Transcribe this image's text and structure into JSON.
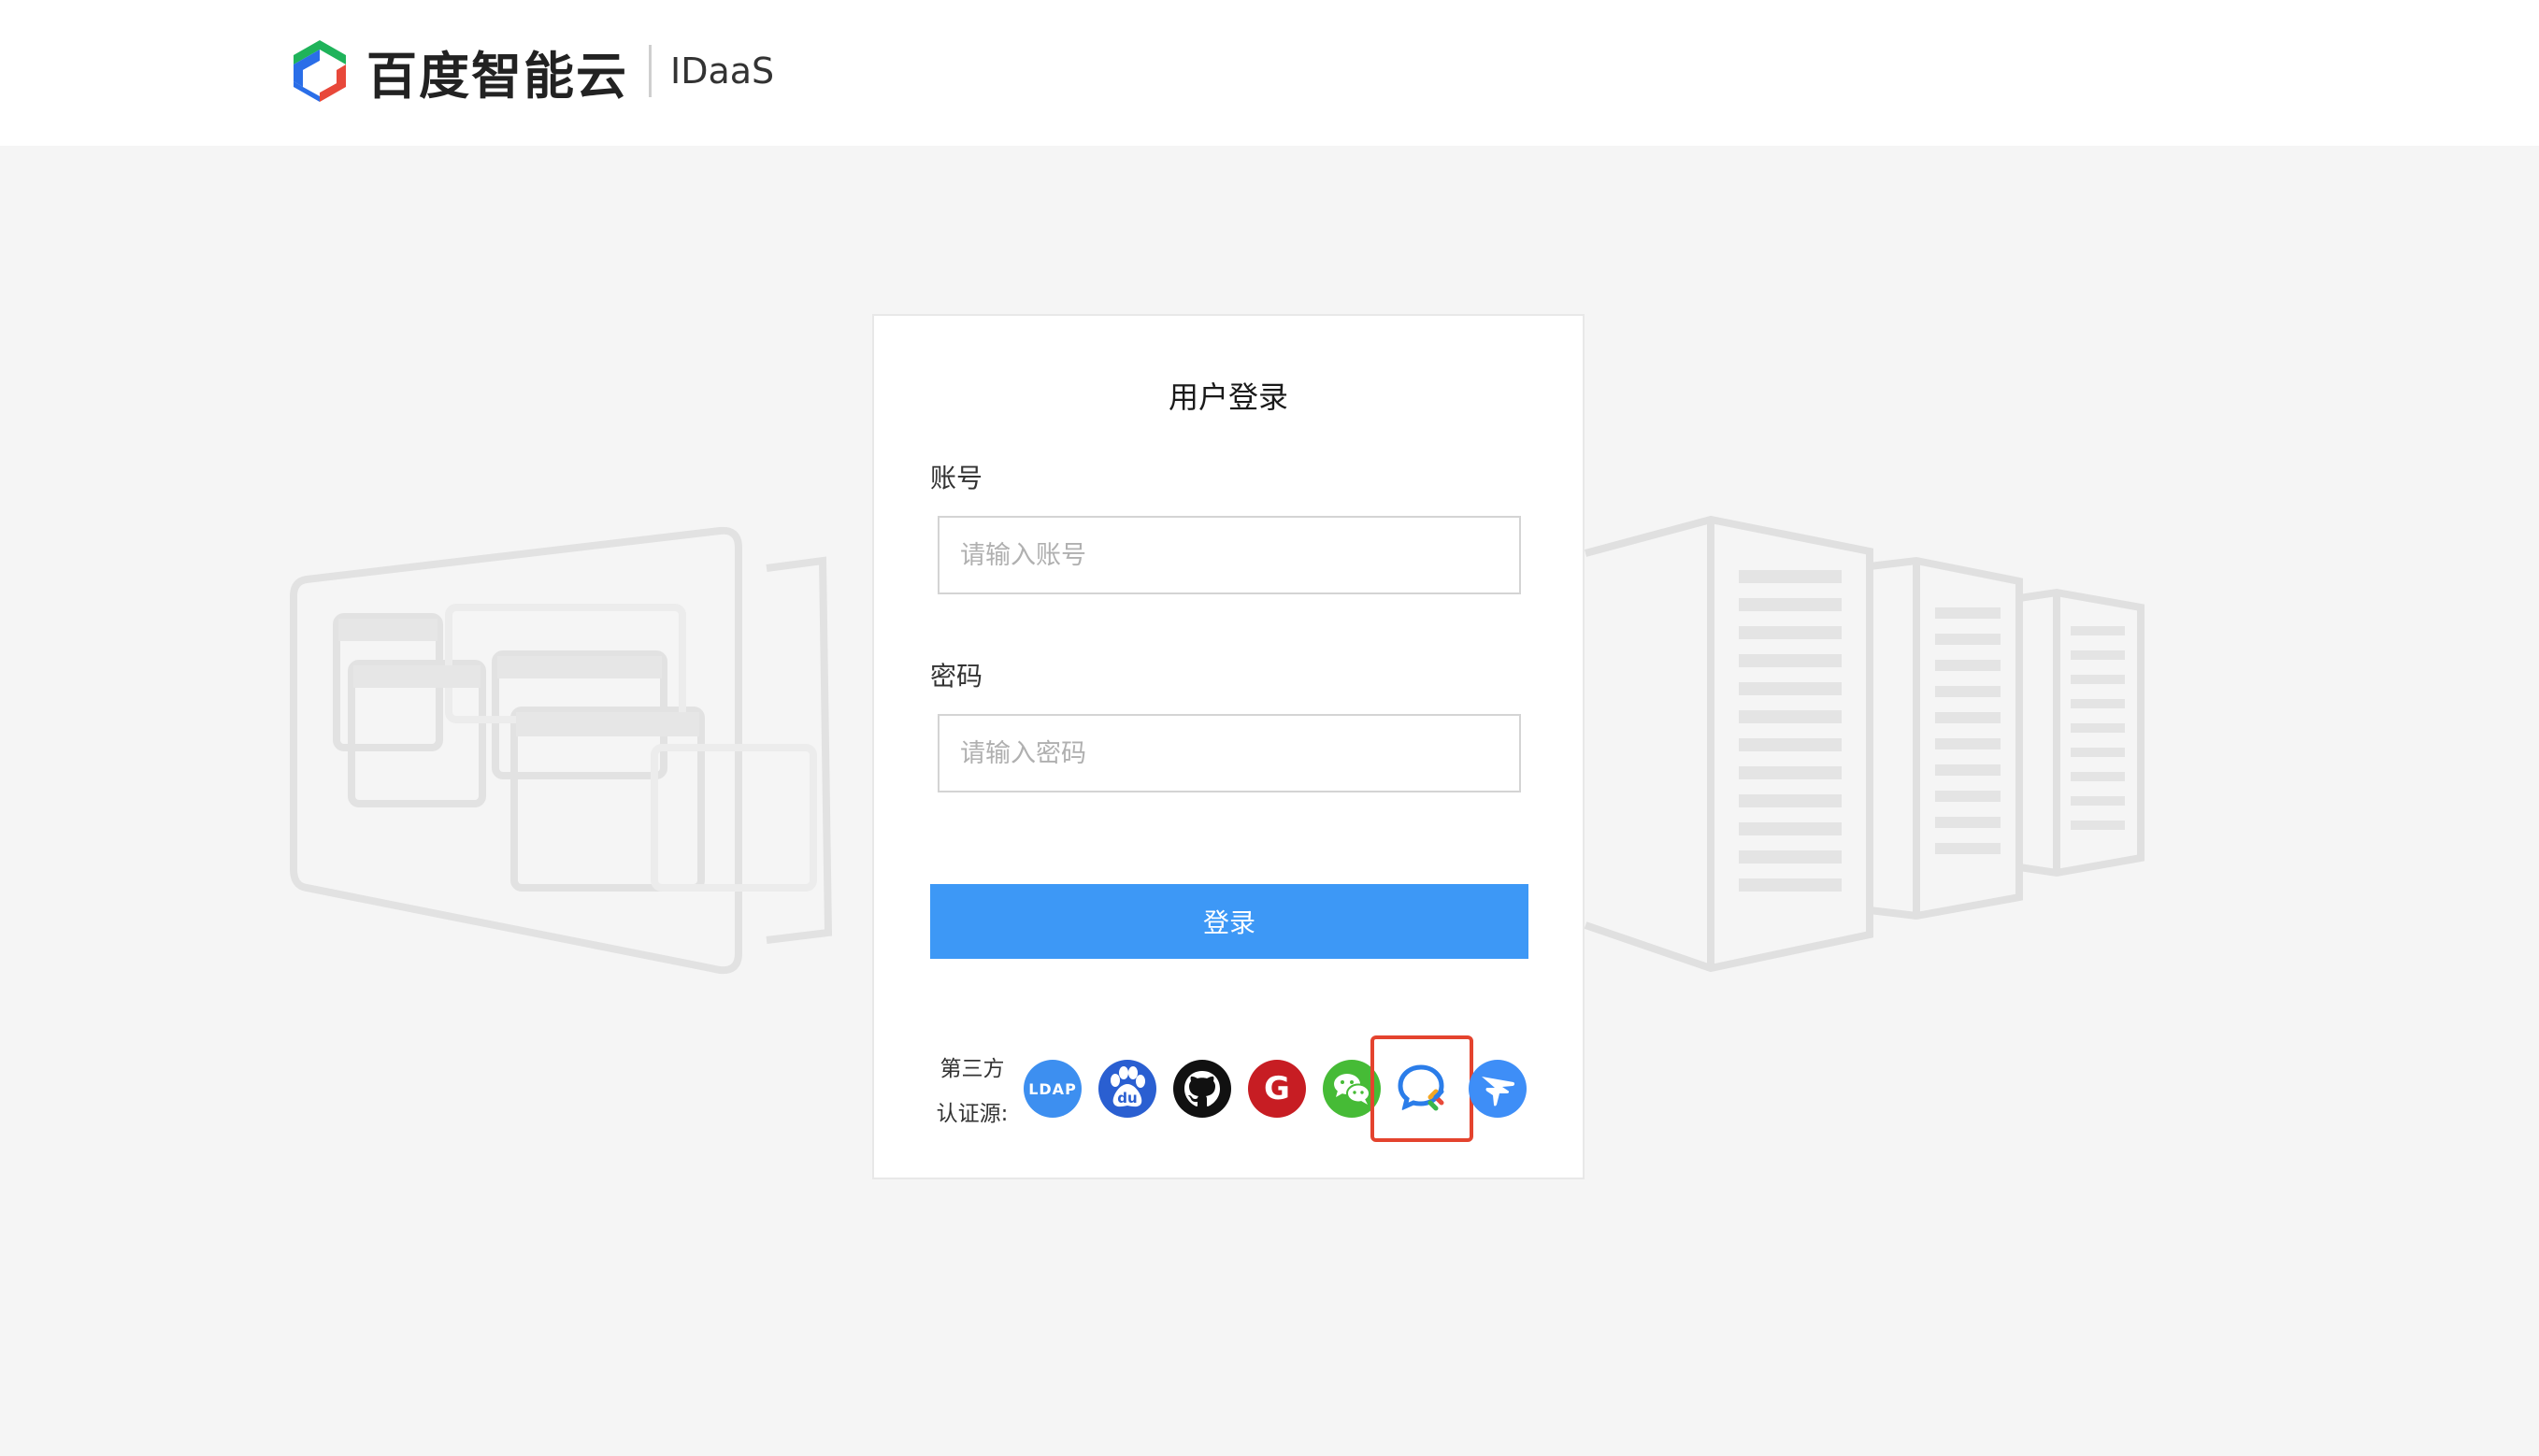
{
  "header": {
    "brand": "百度智能云",
    "product": "IDaaS"
  },
  "login": {
    "title": "用户登录",
    "account_label": "账号",
    "account_placeholder": "请输入账号",
    "account_value": "",
    "password_label": "密码",
    "password_placeholder": "请输入密码",
    "password_value": "",
    "submit_label": "登录"
  },
  "third_party": {
    "label_line1": "第三方",
    "label_line2": "认证源:",
    "providers": [
      {
        "name": "LDAP",
        "icon": "ldap-icon",
        "text": "LDAP",
        "color": "#3d8ff0"
      },
      {
        "name": "Baidu",
        "icon": "baidu-paw-icon",
        "text": "du",
        "color": "#2a5fd1"
      },
      {
        "name": "GitHub",
        "icon": "github-icon",
        "color": "#111111"
      },
      {
        "name": "Gitee",
        "icon": "gitee-icon",
        "text": "G",
        "color": "#c71d23"
      },
      {
        "name": "WeChat",
        "icon": "wechat-icon",
        "color": "#46bb36"
      },
      {
        "name": "WeCom",
        "icon": "wecom-chat-icon",
        "color": "#2b7de9",
        "highlighted": true
      },
      {
        "name": "DingTalk",
        "icon": "dingtalk-icon",
        "color": "#3e8ef7"
      }
    ]
  },
  "colors": {
    "primary": "#3d98f6",
    "highlight": "#e4432e",
    "page_bg": "#f5f5f5"
  }
}
